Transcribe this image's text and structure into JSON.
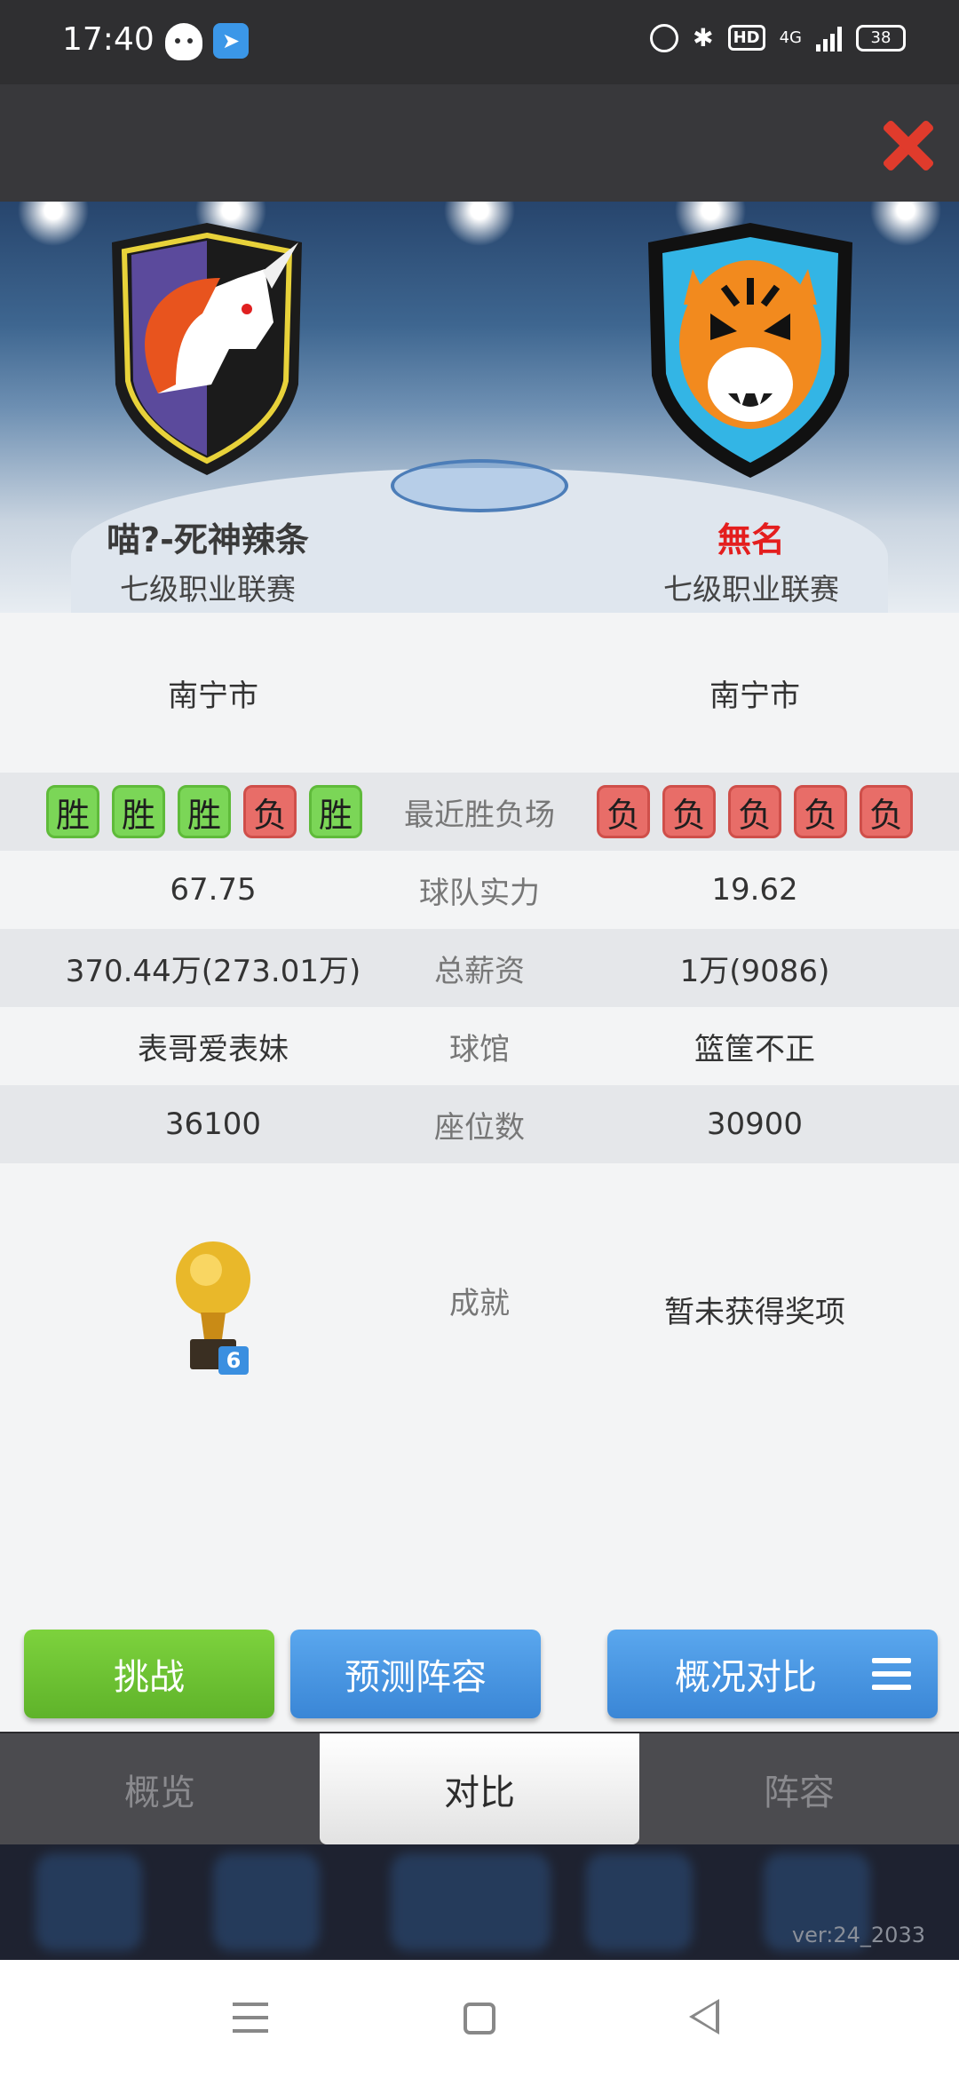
{
  "status_bar": {
    "time": "17:40",
    "network": "4G",
    "battery": "38",
    "hd": "HD"
  },
  "teams": {
    "left": {
      "name": "喵?-死神辣条",
      "league": "七级职业联赛"
    },
    "right": {
      "name": "無名",
      "league": "七级职业联赛"
    }
  },
  "comparison": {
    "city": {
      "left": "南宁市",
      "right": "南宁市"
    },
    "recent": {
      "label": "最近胜负场",
      "left": [
        "胜",
        "胜",
        "胜",
        "负",
        "胜"
      ],
      "right": [
        "负",
        "负",
        "负",
        "负",
        "负"
      ]
    },
    "strength": {
      "label": "球队实力",
      "left": "67.75",
      "right": "19.62"
    },
    "salary": {
      "label": "总薪资",
      "left": "370.44万(273.01万)",
      "right": "1万(9086)"
    },
    "arena": {
      "label": "球馆",
      "left": "表哥爱表妹",
      "right": "篮筐不正"
    },
    "seats": {
      "label": "座位数",
      "left": "36100",
      "right": "30900"
    },
    "achievements": {
      "label": "成就",
      "left_trophy_count": "6",
      "right": "暂未获得奖项"
    }
  },
  "buttons": {
    "challenge": "挑战",
    "predict": "预测阵容",
    "overview_compare": "概况对比"
  },
  "tabs": {
    "overview": "概览",
    "compare": "对比",
    "lineup": "阵容"
  },
  "version": "ver:24_2033",
  "colors": {
    "win": "#7bd657",
    "loss": "#e86d68",
    "accent_blue": "#3a86d6",
    "accent_green": "#5fb32a",
    "close_red": "#e03b2c"
  }
}
